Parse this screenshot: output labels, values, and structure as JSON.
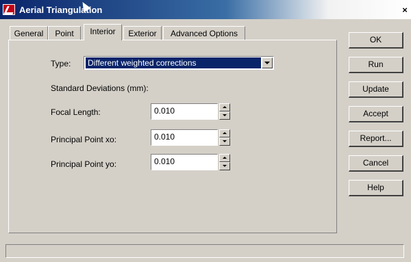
{
  "window": {
    "title": "Aerial Triangulation",
    "close_symbol": "×"
  },
  "tabs": [
    {
      "label": "General"
    },
    {
      "label": "Point"
    },
    {
      "label": "Interior"
    },
    {
      "label": "Exterior"
    },
    {
      "label": "Advanced Options"
    }
  ],
  "active_tab": "Interior",
  "form": {
    "type_label": "Type:",
    "type_value": "Different weighted corrections",
    "std_dev_label": "Standard Deviations (mm):",
    "focal_length_label": "Focal Length:",
    "focal_length_value": "0.010",
    "principal_xo_label": "Principal Point xo:",
    "principal_xo_value": "0.010",
    "principal_yo_label": "Principal Point yo:",
    "principal_yo_value": "0.010"
  },
  "buttons": {
    "ok": "OK",
    "run": "Run",
    "update": "Update",
    "accept": "Accept",
    "report": "Report...",
    "cancel": "Cancel",
    "help": "Help"
  },
  "colors": {
    "titlebar_start": "#0a246a",
    "selection": "#0a246a",
    "face": "#d4d0c8"
  }
}
